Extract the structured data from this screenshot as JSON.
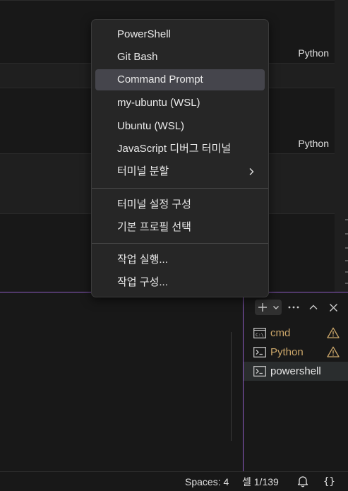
{
  "editor": {
    "cells": [
      {
        "language": "Python"
      },
      {
        "language": "Python"
      }
    ]
  },
  "menu": {
    "items": [
      {
        "label": "PowerShell"
      },
      {
        "label": "Git Bash"
      },
      {
        "label": "Command Prompt"
      },
      {
        "label": "my-ubuntu (WSL)"
      },
      {
        "label": "Ubuntu (WSL)"
      },
      {
        "label": "JavaScript 디버그 터미널"
      },
      {
        "label": "터미널 분할",
        "submenu_icon": "chevron-right-icon"
      }
    ],
    "config_items": [
      {
        "label": "터미널 설정 구성"
      },
      {
        "label": "기본 프로필 선택"
      }
    ],
    "task_items": [
      {
        "label": "작업 실행..."
      },
      {
        "label": "작업 구성..."
      }
    ],
    "highlighted": "Command Prompt"
  },
  "panel": {
    "actions": [
      "plus-icon",
      "chevron-down-icon",
      "ellipsis-icon",
      "chevron-up-icon",
      "close-icon"
    ],
    "terminals": [
      {
        "label": "cmd",
        "icon": "cmd-icon",
        "warning": true
      },
      {
        "label": "Python",
        "icon": "terminal-icon",
        "warning": true
      },
      {
        "label": "powershell",
        "icon": "terminal-icon",
        "warning": false,
        "active": true
      }
    ]
  },
  "statusbar": {
    "spaces": "Spaces: 4",
    "cell": "셀 1/139",
    "notification_icon": "bell-icon",
    "language_icon": "braces-icon"
  },
  "colors": {
    "accent": "#8e5cc4",
    "warning": "#cca76a",
    "menu_highlight": "#45454c"
  }
}
